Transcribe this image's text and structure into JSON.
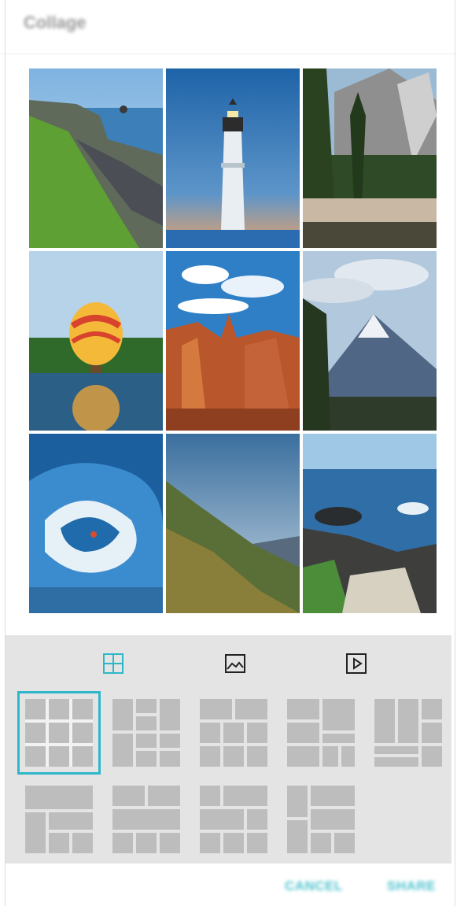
{
  "dialog": {
    "title": "Collage"
  },
  "collage": {
    "tiles": [
      {
        "name": "coast-cliff-photo"
      },
      {
        "name": "lighthouse-photo"
      },
      {
        "name": "mountain-forest-river-photo"
      },
      {
        "name": "hot-air-balloon-photo"
      },
      {
        "name": "red-rock-canyon-photo"
      },
      {
        "name": "snowy-mountain-photo"
      },
      {
        "name": "surfing-wave-photo"
      },
      {
        "name": "green-hillside-photo"
      },
      {
        "name": "rocky-shore-photo"
      }
    ]
  },
  "tabs": [
    {
      "icon": "grid-icon",
      "selected": true
    },
    {
      "icon": "image-icon",
      "selected": false
    },
    {
      "icon": "play-icon",
      "selected": false
    }
  ],
  "layouts": {
    "count": 9,
    "selected_index": 0
  },
  "footer": {
    "cancel_label": "CANCEL",
    "share_label": "SHARE"
  },
  "colors": {
    "accent": "#2fb7c8",
    "tile_gray": "#bdbdbd"
  }
}
